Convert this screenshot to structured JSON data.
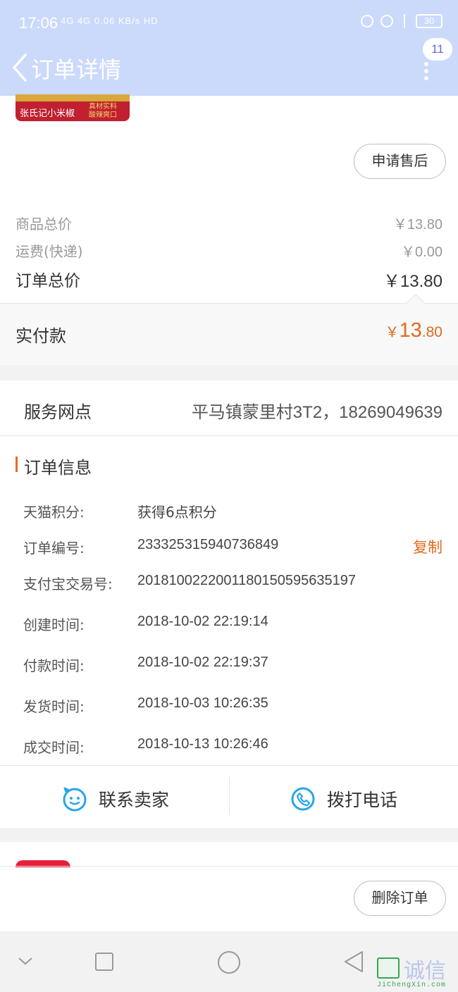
{
  "status_bar": {
    "time": "17:06",
    "network": "4G 4G 0.06 KB/s HD",
    "battery": "30"
  },
  "header": {
    "title": "订单详情",
    "notification_count": "11"
  },
  "product": {
    "thumbnail_brand": "张氏记小米椒",
    "thumbnail_tagline_1": "真材实料",
    "thumbnail_tagline_2": "酸辣爽口"
  },
  "buttons": {
    "after_sale": "申请售后",
    "delete_order": "删除订单",
    "copy": "复制",
    "contact_seller": "联系卖家",
    "call_phone": "拨打电话"
  },
  "price_summary": {
    "goods_total_label": "商品总价",
    "goods_total_value": "￥13.80",
    "shipping_label": "运费(快递)",
    "shipping_value": "￥0.00",
    "order_total_label": "订单总价",
    "order_total_value": "￥13.80",
    "paid_label": "实付款",
    "paid_currency": "￥",
    "paid_integer": "13",
    "paid_decimal": ".80"
  },
  "service_point": {
    "label": "服务网点",
    "value": "平马镇蒙里村3T2，18269049639"
  },
  "order_info": {
    "title": "订单信息",
    "rows": [
      {
        "label": "天猫积分:",
        "value": "获得6点积分"
      },
      {
        "label": "订单编号:",
        "value": "233325315940736849"
      },
      {
        "label": "支付宝交易号:",
        "value": "2018100222001180150595635197"
      },
      {
        "label": "创建时间:",
        "value": "2018-10-02 22:19:14"
      },
      {
        "label": "付款时间:",
        "value": "2018-10-02 22:19:37"
      },
      {
        "label": "发货时间:",
        "value": "2018-10-03 10:26:35"
      },
      {
        "label": "成交时间:",
        "value": "2018-10-13 10:26:46"
      }
    ]
  },
  "watermark": {
    "text_cn": "诚信",
    "text_en": "JiChengXin.com"
  },
  "colors": {
    "header_bg": "#cbd9fb",
    "accent_orange": "#e06a1d",
    "icon_blue": "#28a6e8"
  },
  "icons": {
    "back": "chevron-left-icon",
    "more": "more-vertical-icon",
    "contact": "chat-face-icon",
    "phone": "phone-icon",
    "nav_down": "chevron-down-icon",
    "nav_recent": "square-icon",
    "nav_home": "circle-icon",
    "nav_back": "triangle-back-icon"
  }
}
